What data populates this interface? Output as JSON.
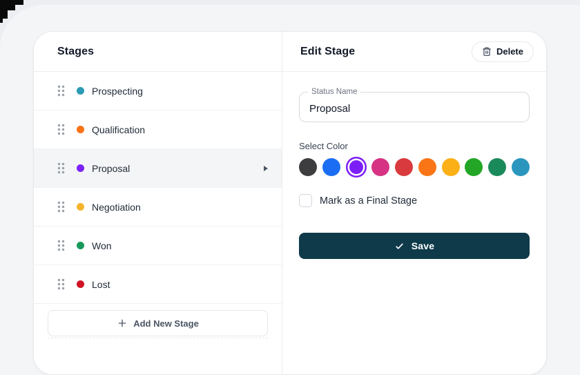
{
  "page": {
    "background": "#eceef1",
    "corner_decoration_color": "#0a0a0a"
  },
  "stages_panel": {
    "title": "Stages",
    "items": [
      {
        "label": "Prospecting",
        "color": "#2b9ab5",
        "selected": false
      },
      {
        "label": "Qualification",
        "color": "#f97316",
        "selected": false
      },
      {
        "label": "Proposal",
        "color": "#7c22f7",
        "selected": true
      },
      {
        "label": "Negotiation",
        "color": "#f5b42c",
        "selected": false
      },
      {
        "label": "Won",
        "color": "#18995c",
        "selected": false
      },
      {
        "label": "Lost",
        "color": "#d01423",
        "selected": false
      }
    ],
    "add_button_label": "Add New Stage"
  },
  "edit_panel": {
    "title": "Edit Stage",
    "delete_button_label": "Delete",
    "status_name": {
      "label": "Status Name",
      "value": "Proposal"
    },
    "select_color_label": "Select Color",
    "colors": [
      {
        "hex": "#3d3d3f",
        "selected": false
      },
      {
        "hex": "#1b6ef3",
        "selected": false
      },
      {
        "hex": "#7c1ff7",
        "selected": true
      },
      {
        "hex": "#d63384",
        "selected": false
      },
      {
        "hex": "#d93a3d",
        "selected": false
      },
      {
        "hex": "#f97516",
        "selected": false
      },
      {
        "hex": "#fbb016",
        "selected": false
      },
      {
        "hex": "#23a626",
        "selected": false
      },
      {
        "hex": "#1b8a5a",
        "selected": false
      },
      {
        "hex": "#2a96be",
        "selected": false
      }
    ],
    "final_stage_checkbox": {
      "label": "Mark as a Final Stage",
      "checked": false
    },
    "save_button_label": "Save",
    "save_button_color": "#0e3a4a"
  }
}
